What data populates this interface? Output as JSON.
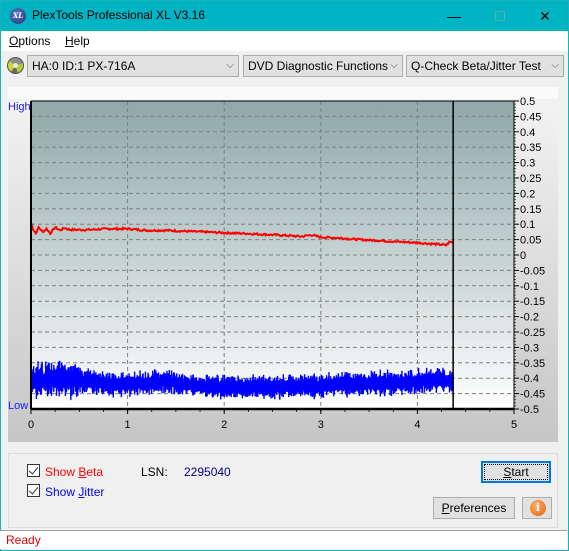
{
  "window": {
    "title": "PlexTools Professional XL V3.16",
    "app_icon": "xl-logo-icon",
    "controls": {
      "minimize": "—",
      "maximize": "□",
      "close": "✕"
    }
  },
  "menu": {
    "items": [
      {
        "label": "Options",
        "mnemonic": "O",
        "rest": "ptions"
      },
      {
        "label": "Help",
        "mnemonic": "H",
        "rest": "elp"
      }
    ]
  },
  "toolbar": {
    "drive_icon": "disc-icon",
    "drive_select": "HA:0 ID:1  PX-716A",
    "function_select": "DVD Diagnostic Functions",
    "test_select": "Q-Check Beta/Jitter Test",
    "dropdown_arrow": "⌵"
  },
  "chart_data": {
    "type": "line",
    "title": "",
    "left_axis": {
      "high_label": "High",
      "low_label": "Low"
    },
    "xlabel": "",
    "ylabel": "",
    "xlim": [
      0,
      5
    ],
    "ylim": [
      -0.5,
      0.5
    ],
    "x_ticks": [
      "0",
      "1",
      "2",
      "3",
      "4",
      "5"
    ],
    "y_ticks": [
      "0.5",
      "0.45",
      "0.4",
      "0.35",
      "0.3",
      "0.25",
      "0.2",
      "0.15",
      "0.1",
      "0.05",
      "0",
      "-0.05",
      "-0.1",
      "-0.15",
      "-0.2",
      "-0.25",
      "-0.3",
      "-0.35",
      "-0.4",
      "-0.45",
      "-0.5"
    ],
    "grid": true,
    "end_marker_x": 4.37,
    "series": [
      {
        "name": "Beta",
        "color": "#ff0000",
        "x": [
          0.0,
          0.02,
          0.05,
          0.08,
          0.12,
          0.16,
          0.2,
          0.25,
          0.3,
          0.35,
          0.4,
          0.6,
          0.8,
          1.0,
          1.2,
          1.4,
          1.6,
          1.8,
          2.0,
          2.2,
          2.4,
          2.6,
          2.8,
          2.9,
          3.0,
          3.2,
          3.4,
          3.6,
          3.8,
          4.0,
          4.2,
          4.3,
          4.33,
          4.37
        ],
        "values": [
          0.105,
          0.085,
          0.07,
          0.09,
          0.075,
          0.085,
          0.07,
          0.09,
          0.08,
          0.088,
          0.082,
          0.082,
          0.085,
          0.085,
          0.08,
          0.08,
          0.077,
          0.075,
          0.072,
          0.07,
          0.067,
          0.064,
          0.06,
          0.065,
          0.058,
          0.055,
          0.05,
          0.047,
          0.043,
          0.04,
          0.035,
          0.032,
          0.042,
          0.042
        ]
      },
      {
        "name": "Jitter",
        "color": "#0000ff",
        "x": [
          0.0,
          0.1,
          0.2,
          0.3,
          0.4,
          0.5,
          0.6,
          0.8,
          1.0,
          1.2,
          1.4,
          1.6,
          1.8,
          2.0,
          2.2,
          2.4,
          2.6,
          2.8,
          3.0,
          3.2,
          3.4,
          3.6,
          3.8,
          4.0,
          4.2,
          4.37
        ],
        "values": [
          -0.41,
          -0.405,
          -0.405,
          -0.395,
          -0.405,
          -0.405,
          -0.41,
          -0.42,
          -0.42,
          -0.415,
          -0.41,
          -0.42,
          -0.425,
          -0.43,
          -0.43,
          -0.43,
          -0.428,
          -0.425,
          -0.425,
          -0.42,
          -0.418,
          -0.415,
          -0.415,
          -0.41,
          -0.405,
          -0.41
        ],
        "band": 0.02
      }
    ]
  },
  "controls": {
    "show_beta": {
      "label": "Show Beta",
      "prefix": "Show ",
      "mnemonic": "B",
      "rest": "eta",
      "checked": true,
      "color": "#ff0000"
    },
    "show_jitter": {
      "label": "Show Jitter",
      "prefix": "Show ",
      "mnemonic": "J",
      "rest": "itter",
      "checked": true,
      "color": "#0000ff"
    },
    "lsn_label": "LSN:",
    "lsn_value": "2295040",
    "start_button": {
      "label": "Start",
      "mnemonic": "S",
      "rest": "tart"
    },
    "preferences_button": {
      "label": "Preferences",
      "mnemonic": "P",
      "rest": "references"
    },
    "info_button": {
      "icon": "info-icon",
      "glyph": "i"
    }
  },
  "status": {
    "text": "Ready"
  }
}
